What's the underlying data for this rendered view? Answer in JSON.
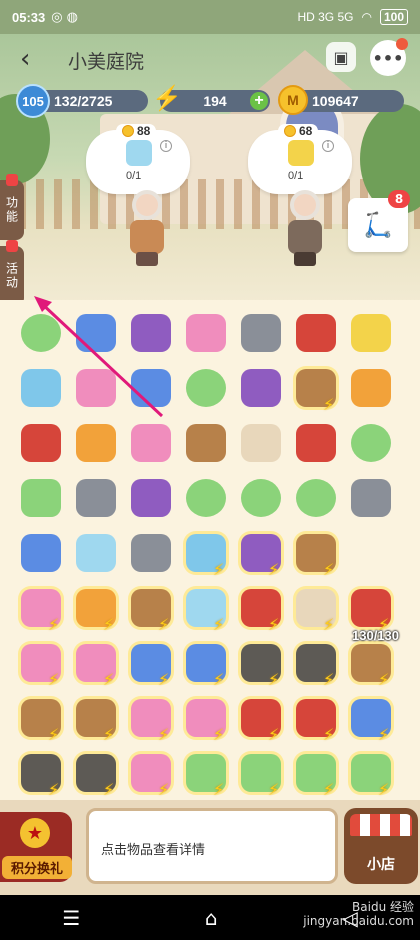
{
  "status": {
    "time": "05:33",
    "network": "HD 3G 5G",
    "battery": "100"
  },
  "header": {
    "title": "小美庭院"
  },
  "resources": {
    "level": "105",
    "exp": "132/2725",
    "energy": "194",
    "coins": "109647"
  },
  "orders": [
    {
      "price": "88",
      "count": "0/1"
    },
    {
      "price": "68",
      "count": "0/1"
    }
  ],
  "side_tabs": [
    "功能",
    "活动"
  ],
  "scooter_badge": "8",
  "board": {
    "storage_count": "130/130",
    "rows": [
      [
        {
          "name": "scissors",
          "c": "green",
          "r": 1
        },
        {
          "name": "water-gun",
          "c": "blue"
        },
        {
          "name": "grapes",
          "c": "purple"
        },
        {
          "name": "cupcake",
          "c": "pink"
        },
        {
          "name": "frying-pan",
          "c": "grey"
        },
        {
          "name": "ribbon-roll",
          "c": "red"
        },
        {
          "name": "cake",
          "c": "yellow"
        }
      ],
      [
        {
          "name": "pencil",
          "c": "cyan"
        },
        {
          "name": "dress",
          "c": "pink"
        },
        {
          "name": "glove",
          "c": "blue"
        },
        {
          "name": "watermelon",
          "c": "green",
          "r": 1
        },
        {
          "name": "jar",
          "c": "purple"
        },
        {
          "name": "parcel",
          "c": "brown",
          "e": 1,
          "g": 1
        },
        {
          "name": "ems-box",
          "c": "orange"
        }
      ],
      [
        {
          "name": "lipstick",
          "c": "red"
        },
        {
          "name": "flower-branch",
          "c": "orange"
        },
        {
          "name": "test-tube",
          "c": "pink"
        },
        {
          "name": "twig",
          "c": "brown"
        },
        {
          "name": "bowl",
          "c": "cream"
        },
        {
          "name": "capsule",
          "c": "red"
        },
        {
          "name": "scissors",
          "c": "green",
          "r": 1
        }
      ],
      [
        {
          "name": "cabbage-box",
          "c": "green"
        },
        {
          "name": "trowel",
          "c": "grey"
        },
        {
          "name": "gift-box",
          "c": "purple"
        },
        {
          "name": "scissors",
          "c": "green",
          "r": 1
        },
        {
          "name": "scissors",
          "c": "green",
          "r": 1
        },
        {
          "name": "scissors",
          "c": "green",
          "r": 1
        },
        {
          "name": "stone-table",
          "c": "grey"
        }
      ],
      [
        {
          "name": "blue-dress",
          "c": "blue"
        },
        {
          "name": "blue-gift",
          "c": "lightblue"
        },
        {
          "name": "stone-lantern",
          "c": "grey"
        },
        {
          "name": "pet-house",
          "c": "cyan",
          "e": 1,
          "g": 1
        },
        {
          "name": "tent",
          "c": "purple",
          "e": 1,
          "g": 1
        },
        {
          "name": "shed",
          "c": "brown",
          "e": 1,
          "g": 1
        },
        {
          "name": "empty",
          "c": ""
        }
      ],
      [
        {
          "name": "pink-box",
          "c": "pink",
          "e": 1,
          "g": 1
        },
        {
          "name": "chicken",
          "c": "orange",
          "e": 1,
          "g": 1
        },
        {
          "name": "shelf",
          "c": "brown",
          "e": 1,
          "g": 1
        },
        {
          "name": "greenhouse",
          "c": "lightblue",
          "e": 1,
          "g": 1
        },
        {
          "name": "furnace",
          "c": "red",
          "e": 1,
          "g": 1
        },
        {
          "name": "kitchen",
          "c": "cream",
          "e": 1,
          "g": 1
        },
        {
          "name": "storage-chest",
          "c": "red",
          "e": 1,
          "g": 1
        }
      ],
      [
        {
          "name": "pink-cabinet",
          "c": "pink",
          "e": 1,
          "g": 1
        },
        {
          "name": "pink-stall",
          "c": "pink",
          "e": 1,
          "g": 1
        },
        {
          "name": "blue-vending",
          "c": "blue",
          "e": 1,
          "g": 1
        },
        {
          "name": "blue-fridge",
          "c": "blue",
          "e": 1,
          "g": 1
        },
        {
          "name": "bbq-grill",
          "c": "darkbox",
          "e": 1,
          "g": 1
        },
        {
          "name": "bbq-grill",
          "c": "darkbox",
          "e": 1,
          "g": 1
        },
        {
          "name": "wood-cabinet",
          "c": "brown",
          "e": 1,
          "g": 1
        }
      ],
      [
        {
          "name": "wood-cabinet",
          "c": "brown",
          "e": 1,
          "g": 1
        },
        {
          "name": "wood-cabinet",
          "c": "brown",
          "e": 1,
          "g": 1
        },
        {
          "name": "pink-bag",
          "c": "pink",
          "e": 1,
          "g": 1
        },
        {
          "name": "pink-bag",
          "c": "pink",
          "e": 1,
          "g": 1
        },
        {
          "name": "red-machine",
          "c": "red",
          "e": 1,
          "g": 1
        },
        {
          "name": "red-machine",
          "c": "red",
          "e": 1,
          "g": 1
        },
        {
          "name": "blue-stall",
          "c": "blue",
          "e": 1,
          "g": 1
        }
      ],
      [
        {
          "name": "iron-box",
          "c": "darkbox",
          "e": 1,
          "g": 1
        },
        {
          "name": "iron-box",
          "c": "darkbox",
          "e": 1,
          "g": 1
        },
        {
          "name": "pink-cart",
          "c": "pink",
          "e": 1,
          "g": 1
        },
        {
          "name": "plant-box",
          "c": "green",
          "e": 1,
          "g": 1
        },
        {
          "name": "plant-box",
          "c": "green",
          "e": 1,
          "g": 1
        },
        {
          "name": "tree-pot",
          "c": "green",
          "e": 1,
          "g": 1
        },
        {
          "name": "tree-pot",
          "c": "green",
          "e": 1,
          "g": 1
        }
      ]
    ]
  },
  "bottom": {
    "left_label": "积分换礼",
    "detail_text": "点击物品查看详情",
    "right_label": "小店"
  },
  "watermark": "Baidu 经验\njingyan.baidu.com",
  "colors": {
    "arrow": "#e0197a",
    "panel": "#e9d9bd"
  }
}
